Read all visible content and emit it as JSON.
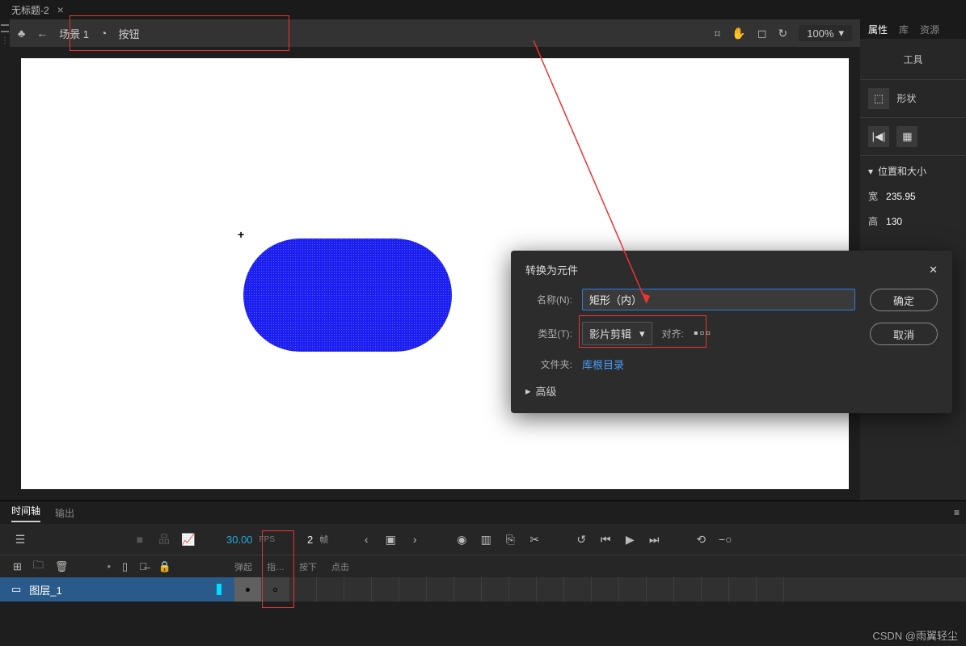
{
  "tab": {
    "title": "无标题-2",
    "close": "×"
  },
  "breadcrumb": {
    "back": "←",
    "scene": "场景 1",
    "symbol": "按钮"
  },
  "zoom": {
    "value": "100%"
  },
  "canvas": {
    "cross": "+"
  },
  "rpanel": {
    "tabs": {
      "props": "属性",
      "lib": "库",
      "assets": "资源"
    },
    "tool_title": "工具",
    "shape_label": "形状",
    "sec_title": "位置和大小",
    "w_label": "宽",
    "w_value": "235.95",
    "h_label": "高",
    "h_value": "130"
  },
  "dialog": {
    "title": "转换为元件",
    "close": "✕",
    "name_label": "名称(N):",
    "name_value": "矩形（内）",
    "type_label": "类型(T):",
    "type_value": "影片剪辑",
    "align_label": "对齐:",
    "folder_label": "文件夹:",
    "folder_value": "库根目录",
    "ok": "确定",
    "cancel": "取消",
    "advanced": "高级"
  },
  "timeline": {
    "tabs": {
      "tl": "时间轴",
      "out": "输出"
    },
    "time": "30.00",
    "fps_label": "FPS",
    "frame_num": "2",
    "frame_label": "帧",
    "states": {
      "s1": "弹起",
      "s2": "指…",
      "s3": "按下",
      "s4": "点击"
    },
    "layer_name": "图层_1"
  },
  "watermark": "CSDN @雨翼轻尘"
}
